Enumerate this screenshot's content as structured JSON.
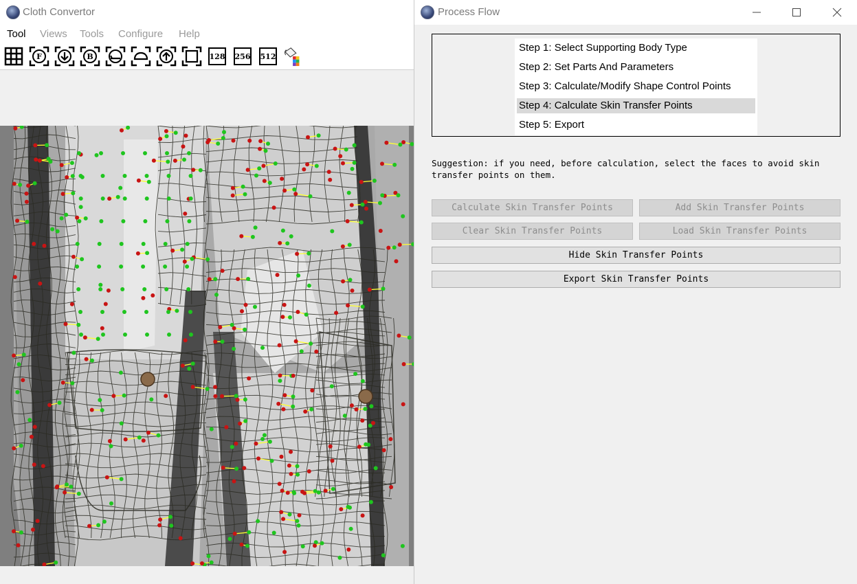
{
  "left_window": {
    "title": "Cloth Convertor",
    "menu": [
      "Tool",
      "Views",
      "Tools",
      "Configure",
      "Help"
    ],
    "toolbar": {
      "letters": [
        "F",
        "B"
      ],
      "size_labels": [
        "128",
        "256",
        "512"
      ],
      "icons": [
        "grid-icon",
        "front-view-icon",
        "download-view-icon",
        "back-view-icon",
        "left-view-icon",
        "cloud-view-icon",
        "upload-view-icon",
        "fit-frame-icon",
        "size-128-icon",
        "size-256-icon",
        "size-512-icon",
        "color-fill-icon"
      ]
    }
  },
  "right_window": {
    "title": "Process Flow",
    "steps": [
      "Step 1: Select Supporting Body Type",
      "Step 2: Set Parts And Parameters",
      "Step 3: Calculate/Modify Shape Control Points",
      "Step 4: Calculate Skin Transfer Points",
      "Step 5: Export"
    ],
    "selected_step_index": 3,
    "suggestion": "Suggestion: if you need, before calculation, select the faces to avoid skin transfer points on them.",
    "buttons": {
      "calculate": "Calculate Skin Transfer Points",
      "add": "Add Skin Transfer Points",
      "clear": "Clear Skin Transfer Points",
      "load": "Load Skin Transfer Points",
      "hide": "Hide Skin Transfer Points",
      "export": "Export Skin Transfer Points"
    },
    "disabled_buttons": [
      "calculate",
      "add",
      "clear",
      "load"
    ]
  },
  "colors": {
    "viewport_bg": "#7f7f7f",
    "green_point": "#1fc51f",
    "red_point": "#c81414",
    "transfer_line": "#ffff33",
    "mesh_line": "#2a2a22"
  }
}
